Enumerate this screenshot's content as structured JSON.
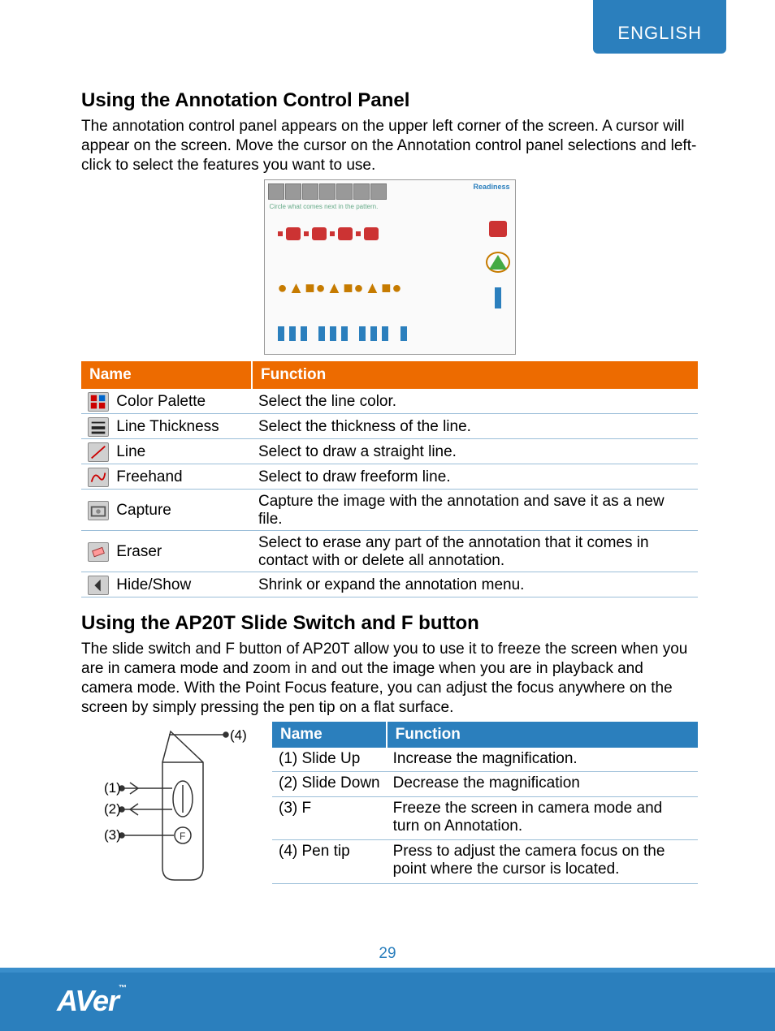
{
  "language_tab": "ENGLISH",
  "page_number": "29",
  "logo_text": "AVer",
  "section1": {
    "title": "Using the Annotation Control Panel",
    "intro": "The annotation control panel appears on the upper left corner of the screen. A cursor will appear on the screen. Move the cursor on the Annotation control panel selections and left-click to select the features you want to use.",
    "screenshot": {
      "readiness": "Readiness",
      "caption": "Circle what comes next in the pattern."
    },
    "table": {
      "headers": {
        "name": "Name",
        "function": "Function"
      },
      "rows": [
        {
          "name": "Color Palette",
          "function": "Select the line color.",
          "icon": "color-palette-icon"
        },
        {
          "name": "Line Thickness",
          "function": "Select the thickness of the line.",
          "icon": "line-thickness-icon"
        },
        {
          "name": "Line",
          "function": "Select to draw a straight line.",
          "icon": "line-icon"
        },
        {
          "name": "Freehand",
          "function": "Select to draw freeform line.",
          "icon": "freehand-icon"
        },
        {
          "name": "Capture",
          "function": "Capture the image with the annotation and save it as a new file.",
          "icon": "capture-icon"
        },
        {
          "name": "Eraser",
          "function": "Select to erase any part of the annotation that it comes in contact with or delete all annotation.",
          "icon": "eraser-icon"
        },
        {
          "name": "Hide/Show",
          "function": "Shrink or expand the annotation menu.",
          "icon": "hide-show-icon"
        }
      ]
    }
  },
  "section2": {
    "title": "Using the AP20T Slide Switch and F button",
    "intro": "The slide switch and F button of AP20T allow you to use it to freeze the screen when you are in camera mode and zoom in and out the image when you are in playback and camera mode. With the Point Focus feature, you can adjust the focus anywhere on the screen by simply pressing the pen tip on a flat surface.",
    "diagram_labels": {
      "l1": "(1)",
      "l2": "(2)",
      "l3": "(3)",
      "l4": "(4)"
    },
    "table": {
      "headers": {
        "name": "Name",
        "function": "Function"
      },
      "rows": [
        {
          "name": "(1) Slide Up",
          "function": "Increase the magnification."
        },
        {
          "name": "(2) Slide Down",
          "function": "Decrease the magnification"
        },
        {
          "name": "(3) F",
          "function": "Freeze the screen in camera mode and turn on Annotation."
        },
        {
          "name": "(4) Pen tip",
          "function": "Press to adjust the camera focus on the point where the cursor is located."
        }
      ]
    }
  }
}
